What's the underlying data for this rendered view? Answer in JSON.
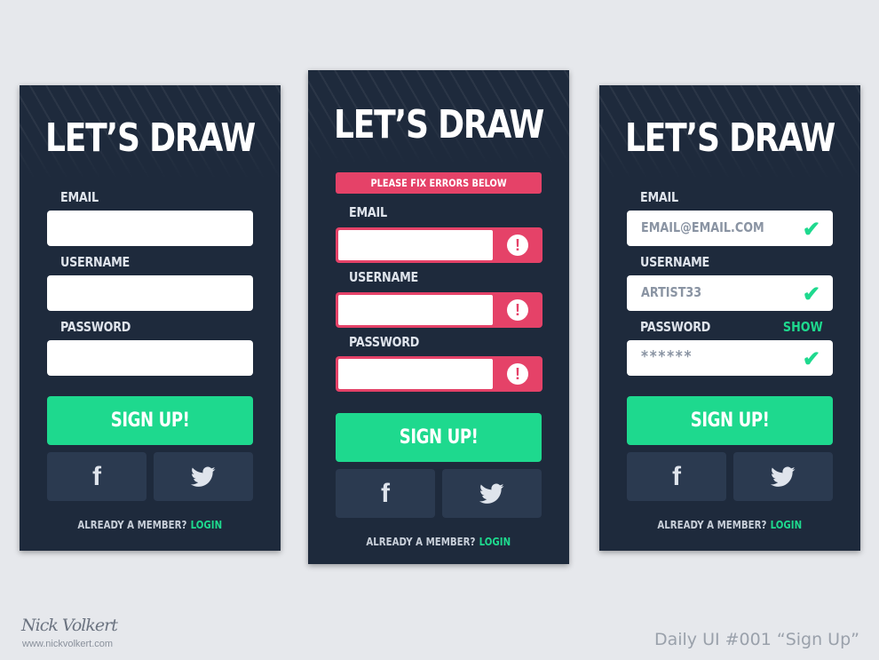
{
  "colors": {
    "background": "#e6e8ec",
    "card": "#1e2a3c",
    "accent_green": "#1ed98e",
    "error_red": "#e54268",
    "social_button": "#2b3a50"
  },
  "cards": [
    {
      "title": "LET’S DRAW",
      "fields": [
        {
          "label": "EMAIL",
          "value": ""
        },
        {
          "label": "USERNAME",
          "value": ""
        },
        {
          "label": "PASSWORD",
          "value": ""
        }
      ],
      "signup_label": "SIGN UP!",
      "footer_question": "ALREADY A MEMBER?",
      "footer_link": "LOGIN",
      "social_icons": [
        "facebook-icon",
        "twitter-icon"
      ]
    },
    {
      "title": "LET’S DRAW",
      "error_banner": "PLEASE FIX ERRORS BELOW",
      "fields": [
        {
          "label": "EMAIL",
          "value": "",
          "state": "error",
          "icon": "alert-icon"
        },
        {
          "label": "USERNAME",
          "value": "",
          "state": "error",
          "icon": "alert-icon"
        },
        {
          "label": "PASSWORD",
          "value": "",
          "state": "error",
          "icon": "alert-icon"
        }
      ],
      "alert_glyph": "!",
      "signup_label": "SIGN UP!",
      "footer_question": "ALREADY A MEMBER?",
      "footer_link": "LOGIN",
      "social_icons": [
        "facebook-icon",
        "twitter-icon"
      ]
    },
    {
      "title": "LET’S DRAW",
      "fields": [
        {
          "label": "EMAIL",
          "value": "EMAIL@EMAIL.COM",
          "state": "valid",
          "icon": "checkmark-icon"
        },
        {
          "label": "USERNAME",
          "value": "ARTIST33",
          "state": "valid",
          "icon": "checkmark-icon"
        },
        {
          "label": "PASSWORD",
          "value": "******",
          "state": "valid",
          "icon": "checkmark-icon"
        }
      ],
      "show_link": "SHOW",
      "signup_label": "SIGN UP!",
      "footer_question": "ALREADY A MEMBER?",
      "footer_link": "LOGIN",
      "social_icons": [
        "facebook-icon",
        "twitter-icon"
      ]
    }
  ],
  "credits": {
    "signature": "Nick Volkert",
    "website": "www.nickvolkert.com",
    "caption": "Daily UI #001 “Sign Up”"
  }
}
